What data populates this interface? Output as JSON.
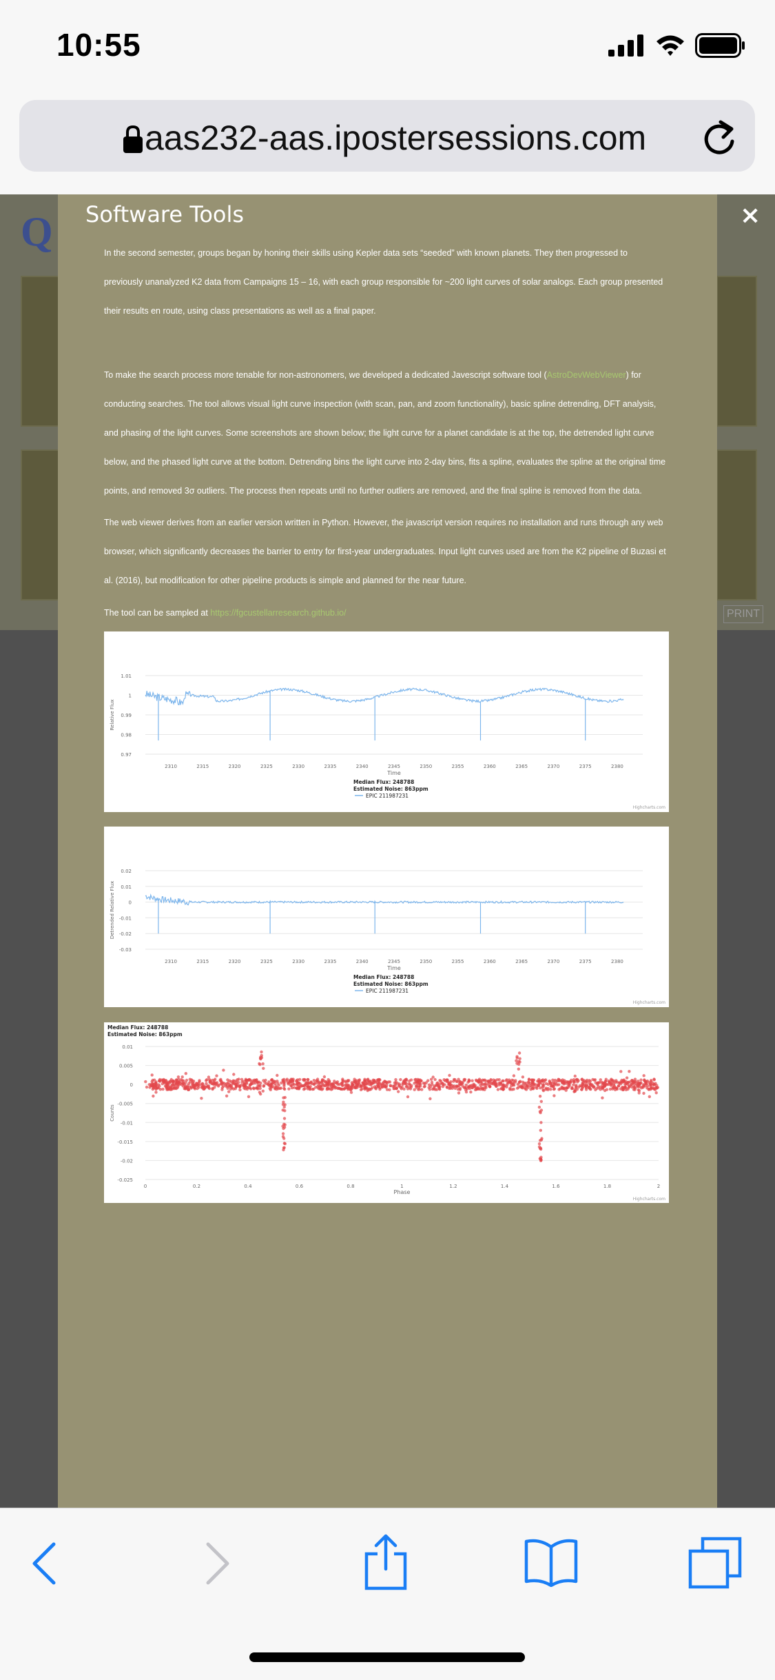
{
  "status": {
    "time": "10:55"
  },
  "browser": {
    "url": "aas232-aas.ipostersessions.com"
  },
  "background": {
    "logo_letter": "Q",
    "print_label": "PRINT"
  },
  "modal": {
    "title": "Software Tools",
    "close_label": "×",
    "p1": "In the second semester, groups began by honing their skills using Kepler data sets “seeded” with known planets. They then progressed to previously unanalyzed K2 data from Campaigns 15 – 16, with each group responsible for ~200 light curves of solar analogs. Each group presented their results en route, using class presentations as well as a final paper.",
    "p2_before": "To make the search process more tenable for non-astronomers, we developed a dedicated Javescript software tool (",
    "p2_link": "AstroDevWebViewer",
    "p2_after": ") for conducting searches. The tool allows visual light curve inspection (with scan, pan, and zoom functionality), basic spline detrending, DFT analysis, and phasing of the light curves. Some screenshots are shown below; the light curve for a planet candidate is at the top, the detrended light curve below, and the phased light curve at the bottom. Detrending bins the light curve into 2-day bins, fits a spline, evaluates the spline at the original time points, and removed 3σ outliers. The process then repeats until no further outliers are removed, and the final spline is removed from the data.",
    "p3": "The web viewer derives from an earlier version written in Python. However, the javascript version requires no installation and runs through any web browser, which significantly decreases the barrier to entry for first-year undergraduates. Input light curves used are from the K2 pipeline of Buzasi et al. (2016), but modification for other pipeline products is simple and planned for the near future.",
    "p4_before": "The tool can be sampled at ",
    "p4_link": "https://fgcustellarresearch.github.io/"
  },
  "chart_data": [
    {
      "type": "line",
      "xlabel": "Time",
      "ylabel": "Relative Flux",
      "x_ticks": [
        "2310",
        "2315",
        "2320",
        "2325",
        "2330",
        "2335",
        "2340",
        "2345",
        "2350",
        "2355",
        "2360",
        "2365",
        "2370",
        "2375",
        "2380"
      ],
      "y_ticks": [
        "1.01",
        "1",
        "0.99",
        "0.98",
        "0.97"
      ],
      "xlim": [
        2306,
        2384
      ],
      "ylim": [
        0.97,
        1.01
      ],
      "legend_median": "Median Flux: 248788",
      "legend_noise": "Estimated Noise: 863ppm",
      "series_name": "EPIC 211987231",
      "credit": "Highcharts.com",
      "color": "#7cb5ec"
    },
    {
      "type": "line",
      "xlabel": "Time",
      "ylabel": "Detrended Relative Flux",
      "x_ticks": [
        "2310",
        "2315",
        "2320",
        "2325",
        "2330",
        "2335",
        "2340",
        "2345",
        "2350",
        "2355",
        "2360",
        "2365",
        "2370",
        "2375",
        "2380"
      ],
      "y_ticks": [
        "0.02",
        "0.01",
        "0",
        "-0.01",
        "-0.02",
        "-0.03"
      ],
      "xlim": [
        2306,
        2384
      ],
      "ylim": [
        -0.03,
        0.02
      ],
      "legend_median": "Median Flux: 248788",
      "legend_noise": "Estimated Noise: 863ppm",
      "series_name": "EPIC 211987231",
      "credit": "Highcharts.com",
      "color": "#7cb5ec"
    },
    {
      "type": "scatter",
      "xlabel": "Phase",
      "ylabel": "Counts",
      "x_ticks": [
        "0",
        "0.2",
        "0.4",
        "0.6",
        "0.8",
        "1",
        "1.2",
        "1.4",
        "1.6",
        "1.8",
        "2"
      ],
      "y_ticks": [
        "0.01",
        "0.005",
        "0",
        "-0.005",
        "-0.01",
        "-0.015",
        "-0.02",
        "-0.025"
      ],
      "xlim": [
        0,
        2
      ],
      "ylim": [
        -0.025,
        0.01
      ],
      "legend_median": "Median Flux: 248788",
      "legend_noise": "Estimated Noise: 863ppm",
      "credit": "Highcharts.com",
      "color": "#e2474b"
    }
  ]
}
